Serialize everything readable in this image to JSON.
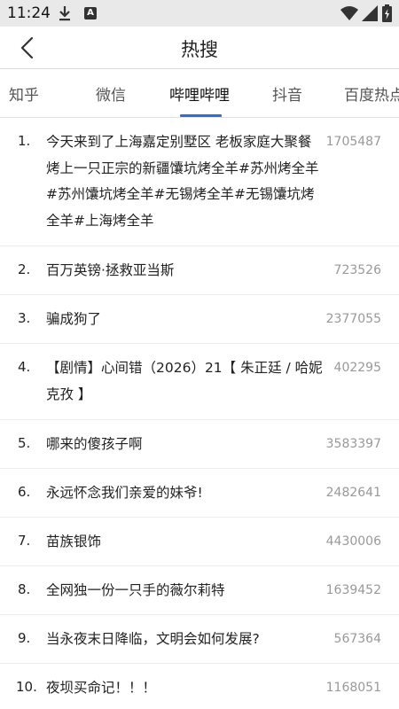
{
  "status_bar": {
    "time": "11:24",
    "icons": [
      "download-icon",
      "a-icon",
      "wifi-icon",
      "signal-icon",
      "battery-icon"
    ]
  },
  "header": {
    "title": "热搜",
    "back_icon": "back-arrow-icon"
  },
  "tabs": [
    {
      "label": "知乎"
    },
    {
      "label": "微信"
    },
    {
      "label": "哔哩哔哩",
      "active": true
    },
    {
      "label": "抖音"
    },
    {
      "label": "百度热点"
    }
  ],
  "colors": {
    "accent": "#2d6fd6",
    "status_bar_bg": "#e9e9e9",
    "count_text": "#999999"
  },
  "list": [
    {
      "rank": "1.",
      "title": "今天来到了上海嘉定别墅区 老板家庭大聚餐烤上一只正宗的新疆馕坑烤全羊#苏州烤全羊#苏州馕坑烤全羊#无锡烤全羊#无锡馕坑烤全羊#上海烤全羊",
      "count": "1705487"
    },
    {
      "rank": "2.",
      "title": "百万英镑·拯救亚当斯",
      "count": "723526"
    },
    {
      "rank": "3.",
      "title": "骗成狗了",
      "count": "2377055"
    },
    {
      "rank": "4.",
      "title": "【剧情】心间错（2026）21【 朱正廷 / 哈妮克孜 】",
      "count": "402295"
    },
    {
      "rank": "5.",
      "title": "哪来的傻孩子啊",
      "count": "3583397"
    },
    {
      "rank": "6.",
      "title": "永远怀念我们亲爱的妹爷!",
      "count": "2482641"
    },
    {
      "rank": "7.",
      "title": "苗族银饰",
      "count": "4430006"
    },
    {
      "rank": "8.",
      "title": "全网独一份一只手的薇尔莉特",
      "count": "1639452"
    },
    {
      "rank": "9.",
      "title": "当永夜末日降临，文明会如何发展?",
      "count": "567364"
    },
    {
      "rank": "10.",
      "title": "夜坝买命记！！！",
      "count": "1168051"
    }
  ]
}
